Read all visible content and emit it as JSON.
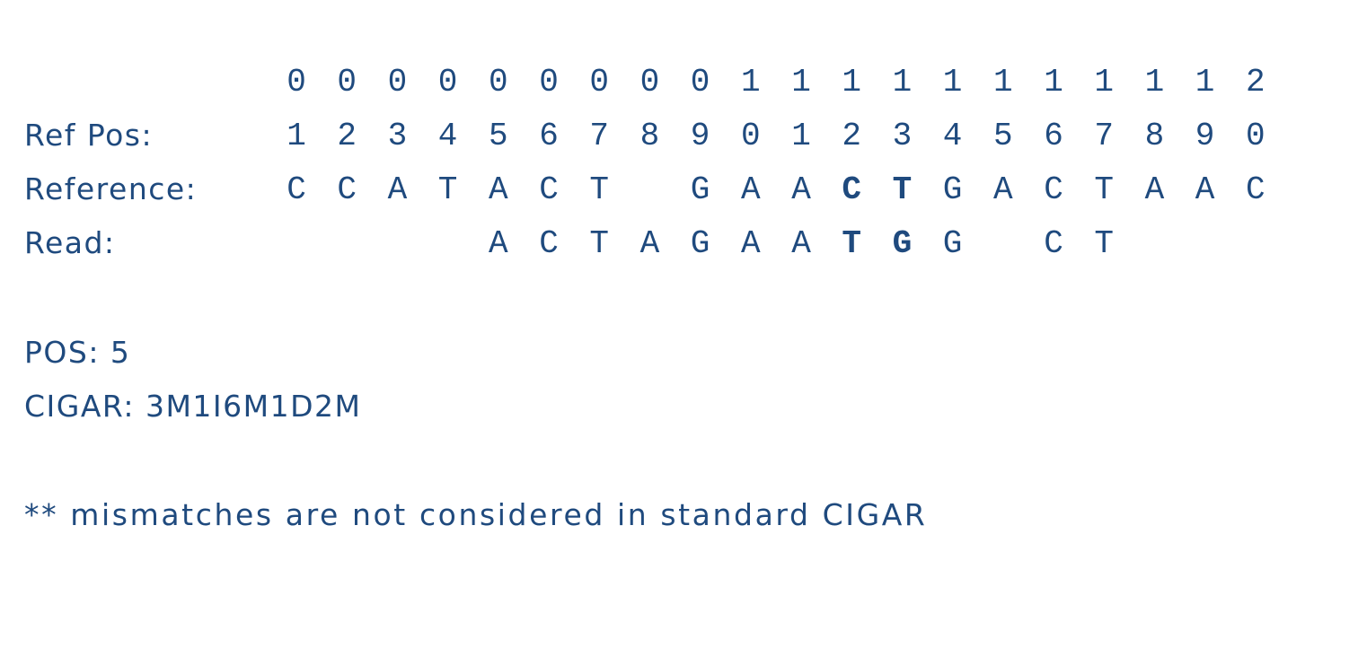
{
  "rows": {
    "tens": {
      "label": "",
      "cells": [
        "0",
        "0",
        "0",
        "0",
        "0",
        "0",
        "0",
        "0",
        "0",
        "1",
        "1",
        "1",
        "1",
        "1",
        "1",
        "1",
        "1",
        "1",
        "1",
        "2"
      ],
      "bold": []
    },
    "ref_pos": {
      "label": "Ref Pos:",
      "cells": [
        "1",
        "2",
        "3",
        "4",
        "5",
        "6",
        "7",
        "8",
        "9",
        "0",
        "1",
        "2",
        "3",
        "4",
        "5",
        "6",
        "7",
        "8",
        "9",
        "0"
      ],
      "bold": []
    },
    "reference": {
      "label": "Reference:",
      "cells": [
        "C",
        "C",
        "A",
        "T",
        "A",
        "C",
        "T",
        "",
        "G",
        "A",
        "A",
        "C",
        "T",
        "G",
        "A",
        "C",
        "T",
        "A",
        "A",
        "C"
      ],
      "bold": [
        11,
        12
      ]
    },
    "read": {
      "label": "Read:",
      "cells": [
        "",
        "",
        "",
        "",
        "A",
        "C",
        "T",
        "A",
        "G",
        "A",
        "A",
        "T",
        "G",
        "G",
        "",
        "C",
        "T",
        "",
        "",
        ""
      ],
      "bold": [
        11,
        12
      ]
    }
  },
  "pos_text": "POS: 5",
  "cigar_text": "CIGAR: 3M1I6M1D2M",
  "note_text": "** mismatches are not considered in standard CIGAR"
}
